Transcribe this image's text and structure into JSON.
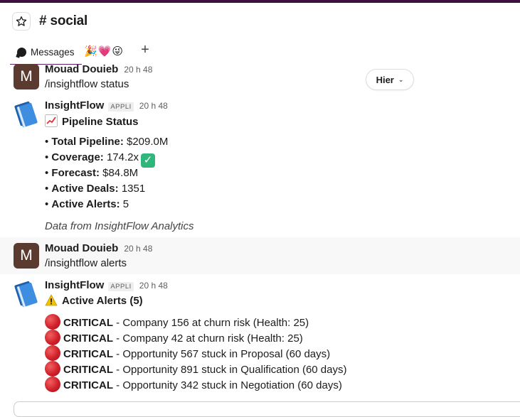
{
  "channel": {
    "title": "# social"
  },
  "tabs": {
    "messages": "Messages",
    "emoji_tab": "🎉💗😜",
    "add": "+"
  },
  "day_divider": {
    "label": "Hier"
  },
  "messages": [
    {
      "author": "Mouad Douieb",
      "avatar_letter": "M",
      "time": "20 h 48",
      "text": "/insightflow status"
    },
    {
      "author": "InsightFlow",
      "badge": "APPLI",
      "time": "20 h 48",
      "heading": "Pipeline Status",
      "items": [
        {
          "label": "Total Pipeline:",
          "value": "$209.0M"
        },
        {
          "label": "Coverage:",
          "value": "174.2x"
        },
        {
          "label": "Forecast:",
          "value": "$84.8M"
        },
        {
          "label": "Active Deals:",
          "value": "1351"
        },
        {
          "label": "Active Alerts:",
          "value": "5"
        }
      ],
      "footer": "Data from InsightFlow Analytics"
    },
    {
      "author": "Mouad Douieb",
      "avatar_letter": "M",
      "time": "20 h 48",
      "text": "/insightflow alerts"
    },
    {
      "author": "InsightFlow",
      "badge": "APPLI",
      "time": "20 h 48",
      "heading": "Active Alerts (5)",
      "alerts": [
        {
          "level": "CRITICAL",
          "text": " - Company 156 at churn risk (Health: 25)"
        },
        {
          "level": "CRITICAL",
          "text": " - Company 42 at churn risk (Health: 25)"
        },
        {
          "level": "CRITICAL",
          "text": " - Opportunity 567 stuck in Proposal (60 days)"
        },
        {
          "level": "CRITICAL",
          "text": " - Opportunity 891 stuck in Qualification (60 days)"
        },
        {
          "level": "CRITICAL",
          "text": " - Opportunity 342 stuck in Negotiation (60 days)"
        }
      ]
    }
  ],
  "colors": {
    "accent": "#611f69",
    "brand_bar": "#3f0e40",
    "success": "#2eb67d",
    "critical": "#d0202a"
  }
}
